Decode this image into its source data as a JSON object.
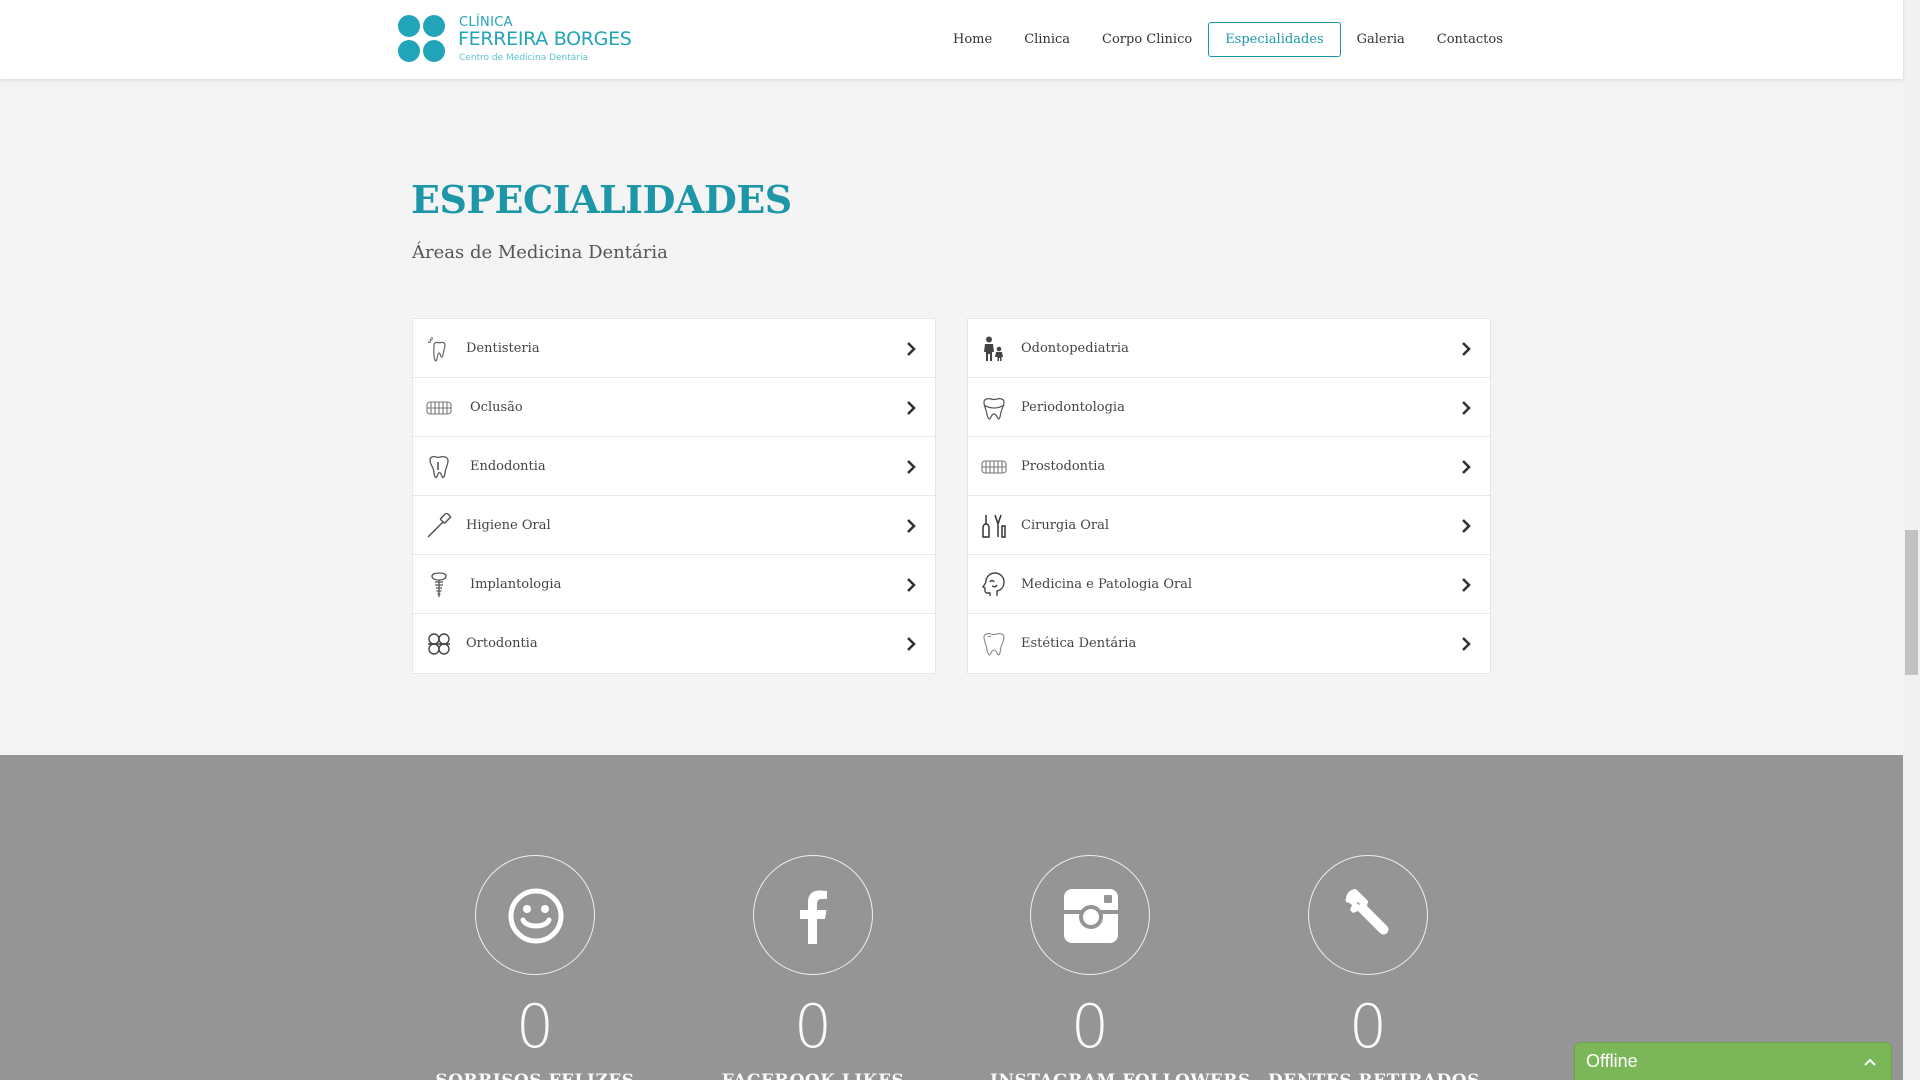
{
  "brand": {
    "line1": "CLÍNICA",
    "line2": "FERREIRA BORGES",
    "tagline": "Centro de Medicina Dentária",
    "color": "#22a5b8"
  },
  "nav": {
    "items": [
      {
        "label": "Home"
      },
      {
        "label": "Clinica"
      },
      {
        "label": "Corpo Clinico"
      },
      {
        "label": "Especialidades",
        "active": true
      },
      {
        "label": "Galeria"
      },
      {
        "label": "Contactos"
      }
    ]
  },
  "section": {
    "title": "ESPECIALIDADES",
    "subtitle": "Áreas de Medicina Dentária"
  },
  "specialties": {
    "left": [
      {
        "label": "Dentisteria",
        "icon": "sparkle-tooth-icon"
      },
      {
        "label": "Oclusão",
        "icon": "teeth-icon"
      },
      {
        "label": "Endodontia",
        "icon": "tooth-root-icon"
      },
      {
        "label": "Higiene Oral",
        "icon": "toothbrush-icon"
      },
      {
        "label": "Implantologia",
        "icon": "implant-icon"
      },
      {
        "label": "Ortodontia",
        "icon": "braces-icon"
      }
    ],
    "right": [
      {
        "label": "Odontopediatria",
        "icon": "parent-child-icon"
      },
      {
        "label": "Periodontologia",
        "icon": "gum-tooth-icon"
      },
      {
        "label": "Prostodontia",
        "icon": "denture-icon"
      },
      {
        "label": "Cirurgia Oral",
        "icon": "surgical-tools-icon"
      },
      {
        "label": "Medicina e Patologia Oral",
        "icon": "head-profile-icon"
      },
      {
        "label": "Estética Dentária",
        "icon": "shiny-tooth-icon"
      }
    ]
  },
  "stats": [
    {
      "value": "0",
      "label": "SORRISOS FELIZES",
      "icon": "smiley-icon"
    },
    {
      "value": "0",
      "label": "FACEBOOK LIKES",
      "icon": "facebook-icon"
    },
    {
      "value": "0",
      "label": "INSTAGRAM FOLLOWERS",
      "icon": "instagram-icon"
    },
    {
      "value": "0",
      "label": "DENTES RETIRADOS",
      "icon": "wrench-icon"
    }
  ],
  "chat": {
    "status": "Offline",
    "color": "#7bb659"
  }
}
